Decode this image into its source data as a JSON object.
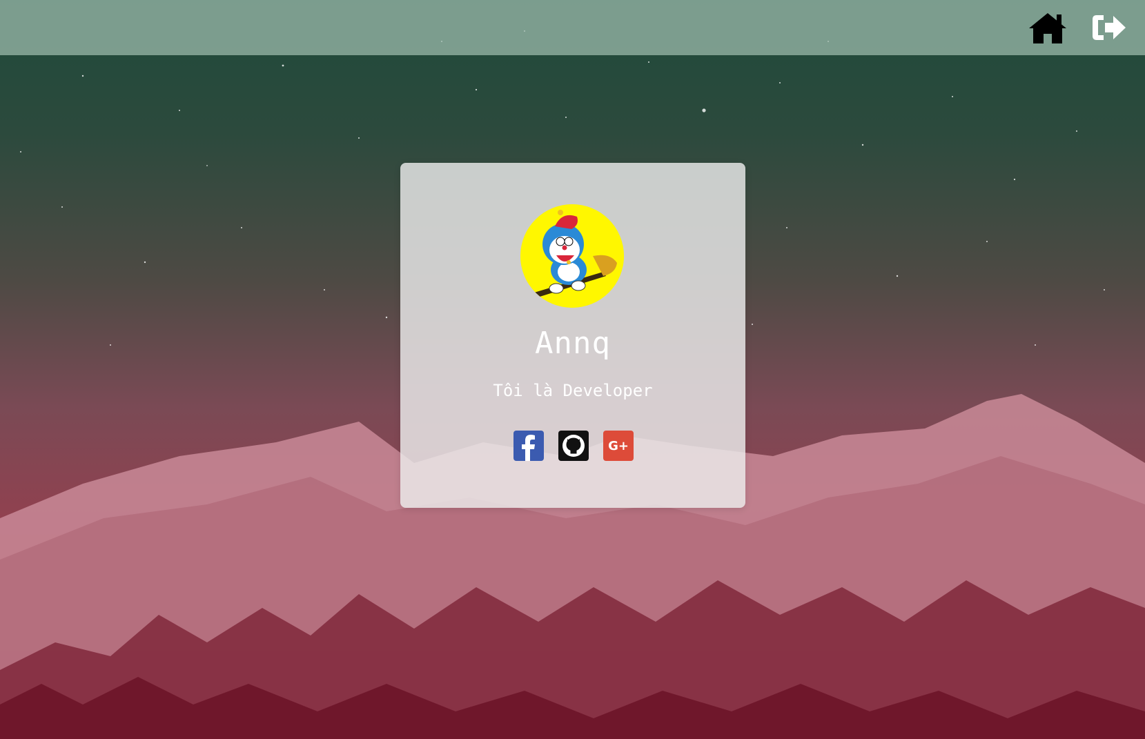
{
  "header": {
    "home_icon": "home-icon",
    "logout_icon": "sign-out-icon"
  },
  "profile": {
    "name": "Annq",
    "tagline": "Tôi là Developer",
    "avatar_icon": "doraemon-avatar"
  },
  "socials": [
    {
      "name": "facebook",
      "icon": "facebook-icon",
      "color": "#3b5bb0"
    },
    {
      "name": "github",
      "icon": "github-icon",
      "color": "#111111"
    },
    {
      "name": "google-plus",
      "icon": "google-plus-icon",
      "label": "G+",
      "color": "#dd4b39"
    }
  ],
  "colors": {
    "topbar": "#a0beaf",
    "card": "#ebebeb",
    "sky_top": "#1f4a3a",
    "sky_bottom": "#8a2034"
  }
}
